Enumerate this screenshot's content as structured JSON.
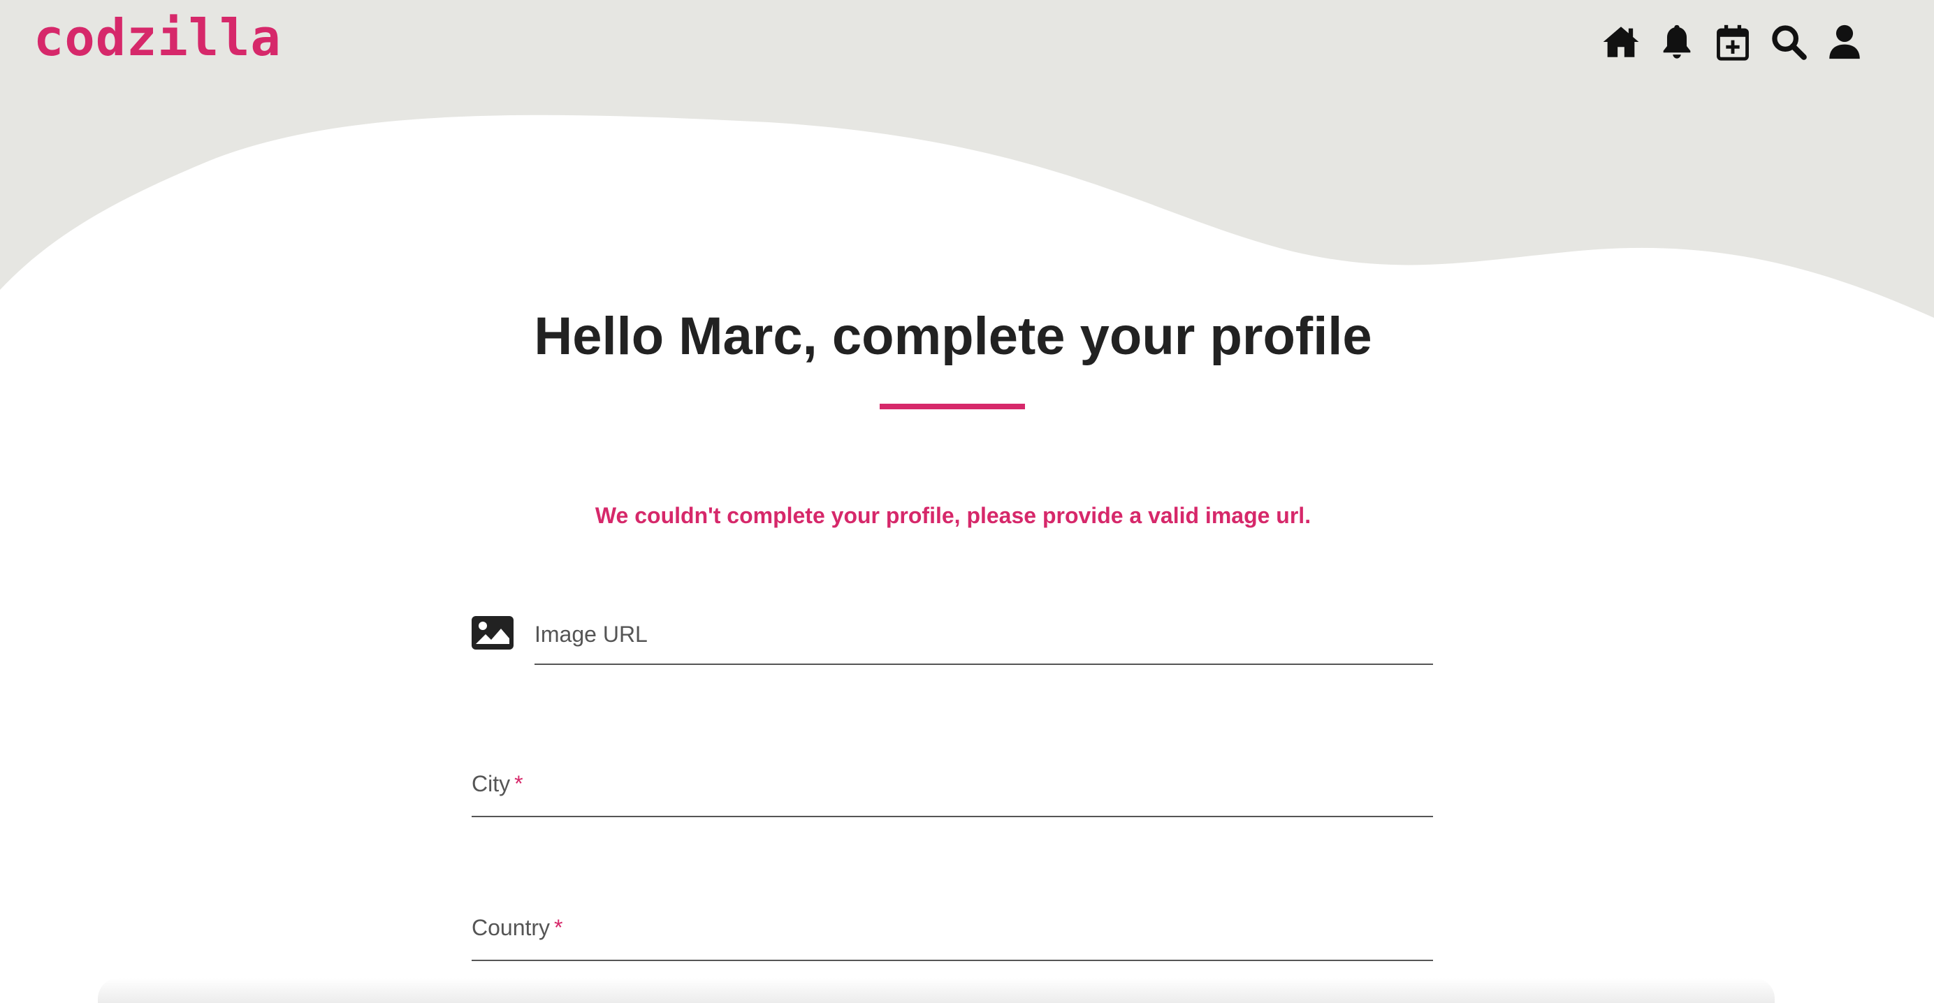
{
  "header": {
    "logo_text": "codzilla",
    "brand_color": "#d6286a",
    "icons": [
      "home-icon",
      "bell-icon",
      "calendar-plus-icon",
      "search-icon",
      "user-icon"
    ]
  },
  "main": {
    "title": "Hello Marc, complete your profile",
    "error_message": "We couldn't complete your profile, please provide a valid image url.",
    "fields": {
      "image_url": {
        "label": "Image URL",
        "value": ""
      },
      "city": {
        "label": "City",
        "required_marker": "*",
        "value": ""
      },
      "country": {
        "label": "Country",
        "required_marker": "*",
        "value": ""
      }
    }
  },
  "colors": {
    "header_bg": "#e6e6e2",
    "accent": "#d6286a",
    "text": "#222222"
  }
}
